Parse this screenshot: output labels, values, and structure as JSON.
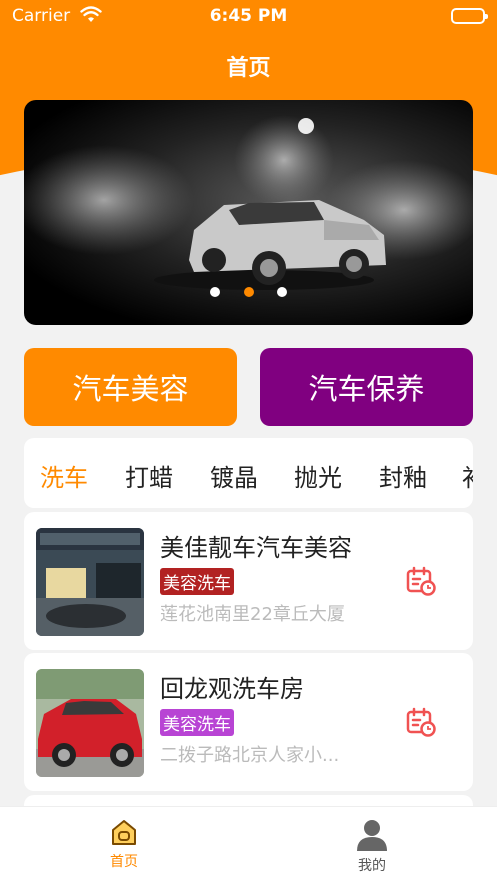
{
  "status_bar": {
    "carrier": "Carrier",
    "time": "6:45 PM"
  },
  "nav": {
    "title": "首页"
  },
  "banner": {
    "slide_count": 3,
    "active_slide": 2
  },
  "actions": {
    "beauty_label": "汽车美容",
    "maintenance_label": "汽车保养"
  },
  "categories": [
    "洗车",
    "打蜡",
    "镀晶",
    "抛光",
    "封釉",
    "补"
  ],
  "active_category": 0,
  "shops": [
    {
      "name": "美佳靓车汽车美容",
      "tag": "美容洗车",
      "tag_color": "#b22222",
      "address": "莲花池南里22章丘大厦",
      "calendar_icon": "calendar-clock-icon"
    },
    {
      "name": "回龙观洗车房",
      "tag": "美容洗车",
      "tag_color": "#b844d4",
      "address": "二拨子路北京人家小...",
      "calendar_icon": "calendar-clock-icon"
    }
  ],
  "tabbar": {
    "home_label": "首页",
    "mine_label": "我的"
  },
  "colors": {
    "accent": "#ff8a00",
    "purple": "#800080",
    "calendar_icon": "#f05252"
  }
}
